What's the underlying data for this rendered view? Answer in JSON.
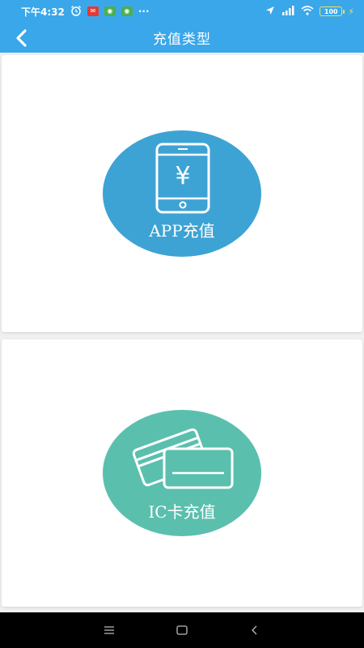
{
  "status_bar": {
    "time": "下午4:32",
    "dots": "···",
    "battery": "100",
    "badges": [
      "mail-red",
      "wechat-green",
      "wechat-green"
    ]
  },
  "header": {
    "title": "充值类型",
    "back_icon": "chevron-left-icon"
  },
  "options": [
    {
      "label": "APP充值",
      "icon": "phone-yen-icon",
      "color": "#3da3d4"
    },
    {
      "label": "IC卡充值",
      "icon": "cards-icon",
      "color": "#5bbfae"
    }
  ],
  "theme": {
    "primary": "#3aa7ea",
    "background": "#f0f0f0"
  },
  "nav_bar": {
    "buttons": [
      "menu-icon",
      "home-square-icon",
      "back-triangle-icon"
    ]
  }
}
